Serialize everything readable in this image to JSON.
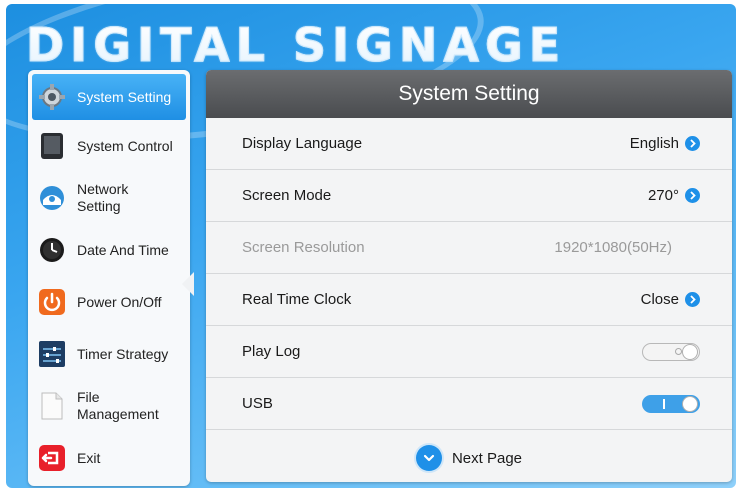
{
  "brand": "DIGITAL SIGNAGE",
  "sidebar": {
    "items": [
      {
        "label": "System Setting",
        "icon": "gear-icon",
        "active": true
      },
      {
        "label": "System Control",
        "icon": "tablet-icon"
      },
      {
        "label": "Network Setting",
        "icon": "network-icon"
      },
      {
        "label": "Date And Time",
        "icon": "clock-icon"
      },
      {
        "label": "Power On/Off",
        "icon": "power-icon"
      },
      {
        "label": "Timer Strategy",
        "icon": "sliders-icon"
      },
      {
        "label": "File Management",
        "icon": "file-icon"
      },
      {
        "label": "Exit",
        "icon": "exit-icon"
      }
    ]
  },
  "panel": {
    "title": "System Setting",
    "rows": [
      {
        "label": "Display Language",
        "value": "English",
        "type": "select"
      },
      {
        "label": "Screen Mode",
        "value": "270°",
        "type": "select"
      },
      {
        "label": "Screen Resolution",
        "value": "1920*1080(50Hz)",
        "type": "readonly"
      },
      {
        "label": "Real Time Clock",
        "value": "Close",
        "type": "select"
      },
      {
        "label": "Play Log",
        "value": false,
        "type": "toggle"
      },
      {
        "label": "USB",
        "value": true,
        "type": "toggle"
      }
    ],
    "next_label": "Next Page"
  },
  "colors": {
    "accent": "#1e90e8",
    "header": "#58595c",
    "background": "#3aa6f0"
  }
}
